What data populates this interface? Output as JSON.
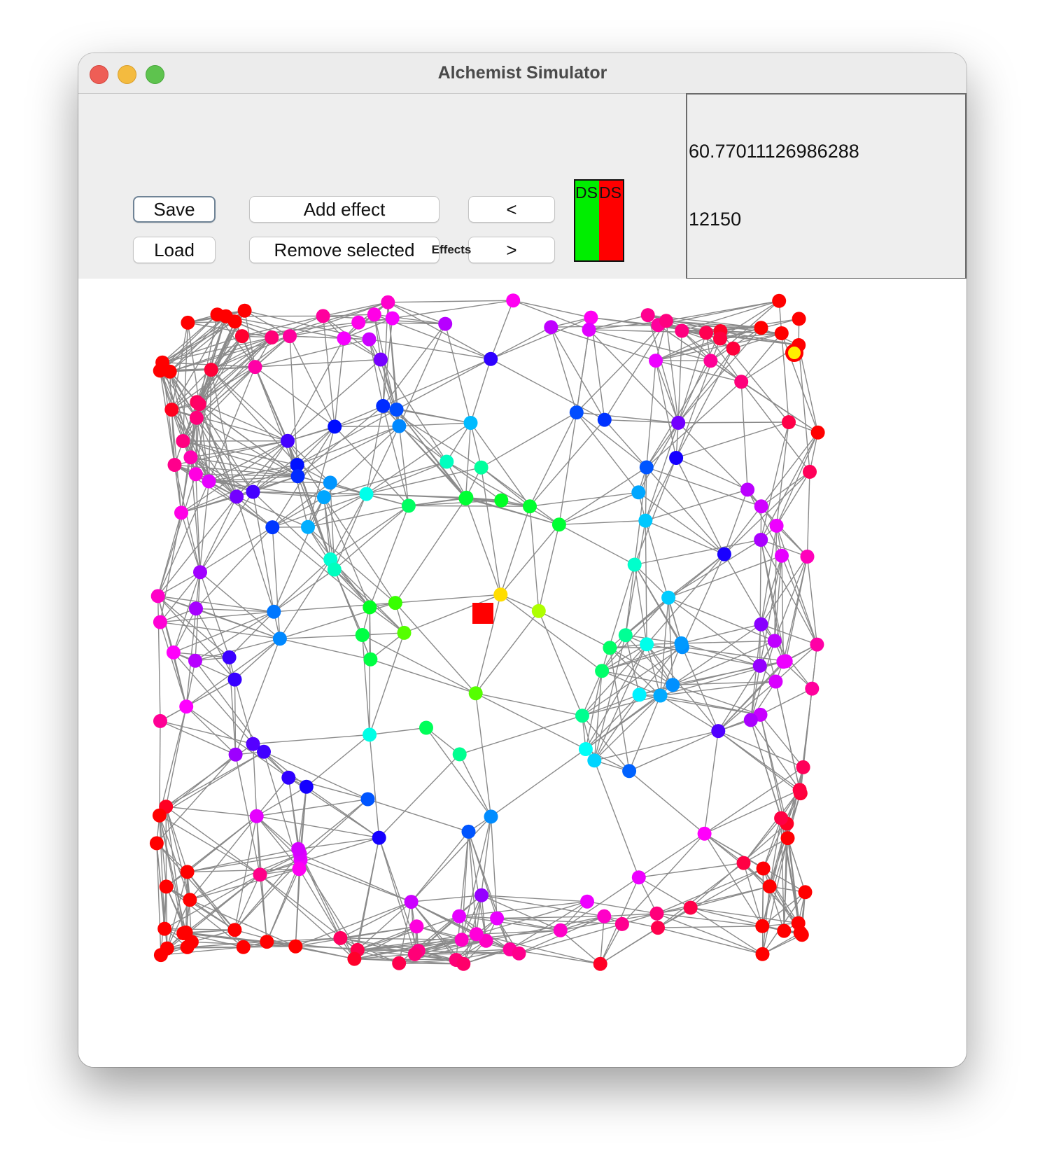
{
  "window": {
    "title": "Alchemist Simulator"
  },
  "toolbar": {
    "save_label": "Save",
    "load_label": "Load",
    "add_effect_label": "Add effect",
    "remove_selected_label": "Remove selected",
    "prev_label": "<",
    "next_label": ">",
    "effects_label": "Effects"
  },
  "swatch": {
    "left_label": "DS",
    "right_label": "DS",
    "left_color": "#00ee00",
    "right_color": "#ff0000"
  },
  "info": {
    "value": "60.77011126986288",
    "step": "12150"
  },
  "colors": {
    "edge": "#8a8a8a",
    "background": "#ffffff"
  }
}
